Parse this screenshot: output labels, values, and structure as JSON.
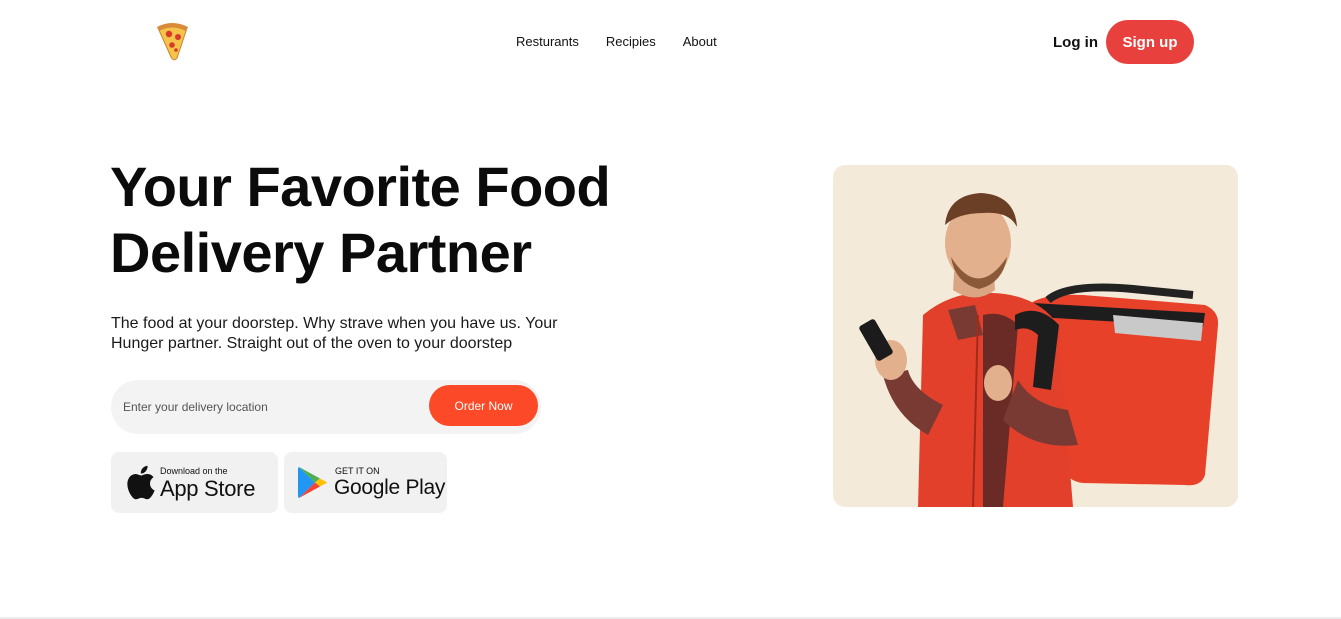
{
  "header": {
    "logo": "pizza-slice-icon",
    "nav_items": [
      {
        "label": "Resturants"
      },
      {
        "label": "Recipies"
      },
      {
        "label": "About"
      }
    ],
    "login_label": "Log in",
    "signup_label": "Sign up"
  },
  "hero": {
    "title_line1": "Your Favorite Food",
    "title_line2": "Delivery Partner",
    "subtitle": "The food at your doorstep. Why strave when you have us. Your Hunger partner. Straight out of the oven to your doorstep",
    "search": {
      "placeholder": "Enter your delivery location",
      "value": "",
      "button_label": "Order Now"
    },
    "stores": {
      "appstore_small": "Download on the",
      "appstore_big": "App Store",
      "googleplay_small": "GET IT ON",
      "googleplay_big": "Google Play"
    },
    "image_alt": "delivery-man-with-phone-and-red-backpack"
  },
  "colors": {
    "accent": "#e8403c",
    "order_button": "#fc4a28",
    "hero_card_bg": "#f3ead9",
    "input_bg": "#f3f3f3"
  }
}
